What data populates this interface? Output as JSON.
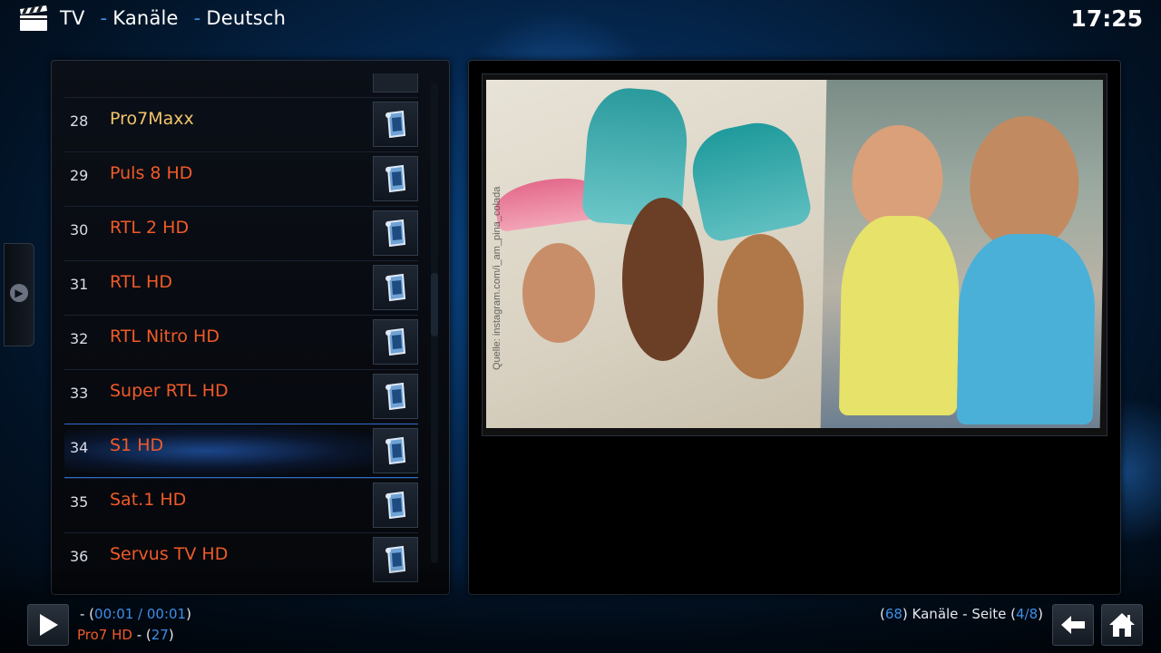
{
  "header": {
    "crumbs": [
      "TV",
      "Kanäle",
      "Deutsch"
    ],
    "separator": "-",
    "clock": "17:25"
  },
  "channels": [
    {
      "num": "28",
      "name": "Pro7Maxx",
      "playing": true
    },
    {
      "num": "29",
      "name": "Puls 8 HD"
    },
    {
      "num": "30",
      "name": "RTL 2 HD"
    },
    {
      "num": "31",
      "name": "RTL HD"
    },
    {
      "num": "32",
      "name": "RTL Nitro HD"
    },
    {
      "num": "33",
      "name": "Super RTL HD"
    },
    {
      "num": "34",
      "name": "S1 HD",
      "selected": true
    },
    {
      "num": "35",
      "name": "Sat.1 HD"
    },
    {
      "num": "36",
      "name": "Servus TV HD"
    }
  ],
  "video": {
    "watermark": "Quelle: instagram.com/i_am_pina_colada"
  },
  "now_playing": {
    "prefix": "- (",
    "elapsed": "00:01",
    "slash": " / ",
    "total": "00:01",
    "suffix": ")",
    "channel": "Pro7 HD",
    "channel_sep": " - (",
    "channel_num": "27",
    "channel_end": ")"
  },
  "pager": {
    "open": "(",
    "count": "68",
    "mid": ") Kanäle - Seite (",
    "page": "4/8",
    "close": ")"
  },
  "colors": {
    "accent": "#3d8ee8",
    "channel_text": "#f05a28",
    "playing_text": "#f2c46b"
  },
  "icons": {
    "header": "clapperboard-icon",
    "back": "arrow-left-icon",
    "home": "home-icon",
    "play": "play-icon",
    "channel": "tv-channel-icon"
  }
}
